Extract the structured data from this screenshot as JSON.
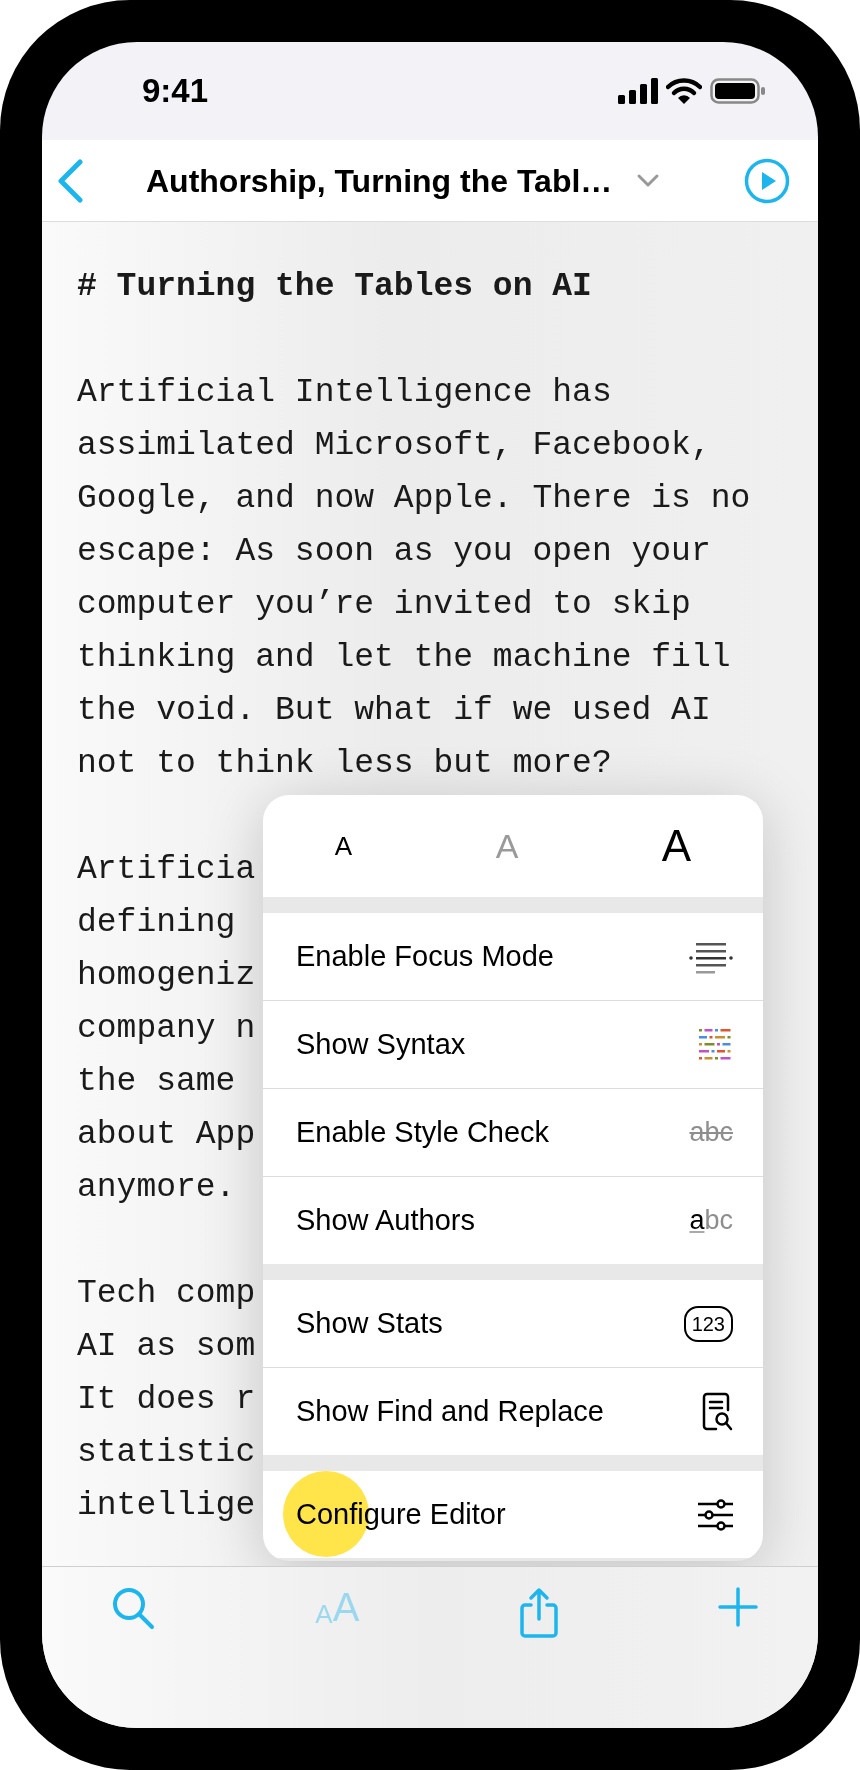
{
  "status_bar": {
    "time": "9:41"
  },
  "nav_bar": {
    "title": "Authorship, Turning the Tabl…"
  },
  "document": {
    "heading": "# Turning the Tables on AI",
    "paragraphs": [
      [
        "Artificial Intelligence has",
        "assimilated Microsoft, Facebook,",
        "Google, and now Apple. There is no",
        "escape: As soon as you open your",
        "computer you’re invited to skip",
        "thinking and let the machine fill",
        "the void. But what if we used AI",
        "not to think less but more?"
      ],
      [
        "Artificia",
        "defining",
        "homogeniz",
        "company n",
        "the same",
        "about App",
        "anymore."
      ],
      [
        "Tech comp",
        "AI as som",
        "It does r",
        "statistic",
        "intellige"
      ]
    ]
  },
  "menu": {
    "font_sizes": [
      {
        "label": "A",
        "kind": "small",
        "selected": false
      },
      {
        "label": "A",
        "kind": "medium",
        "selected": true
      },
      {
        "label": "A",
        "kind": "large",
        "selected": false
      }
    ],
    "groups": [
      [
        {
          "label": "Enable Focus Mode",
          "kind": "focus"
        },
        {
          "label": "Show Syntax",
          "kind": "syntax"
        },
        {
          "label": "Enable Style Check",
          "kind": "style",
          "glyph": "abc"
        },
        {
          "label": "Show Authors",
          "kind": "authors",
          "glyph": "abc"
        }
      ],
      [
        {
          "label": "Show Stats",
          "kind": "stats",
          "glyph": "123"
        },
        {
          "label": "Show Find and Replace",
          "kind": "find"
        }
      ],
      [
        {
          "label": "Configure Editor",
          "kind": "configure",
          "tapped": true
        }
      ]
    ]
  },
  "toolbar": {
    "text_size": {
      "small": "A",
      "large": "A",
      "disabled": true
    }
  }
}
